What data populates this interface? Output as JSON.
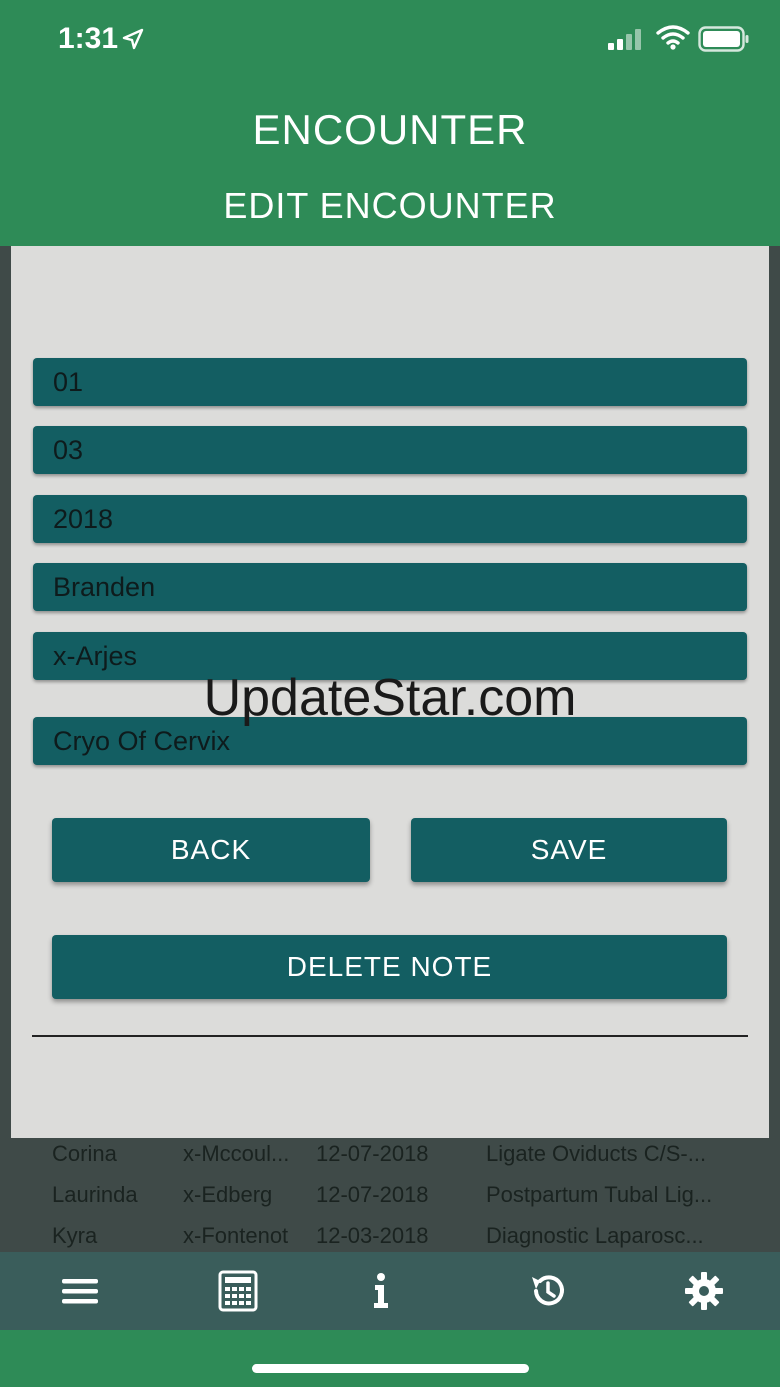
{
  "status_bar": {
    "time": "1:31"
  },
  "header": {
    "app_title": "ENCOUNTER",
    "page_title": "EDIT ENCOUNTER"
  },
  "form": {
    "month": "01",
    "day": "03",
    "year": "2018",
    "first_name": "Branden",
    "last_name": "x-Arjes",
    "procedure": "Cryo Of Cervix"
  },
  "buttons": {
    "back": "BACK",
    "save": "SAVE",
    "delete": "DELETE NOTE"
  },
  "watermark": "UpdateStar.com",
  "list": {
    "rows": [
      {
        "first": "Corina",
        "last": "x-Mccoul...",
        "date": "12-07-2018",
        "procedure": "Ligate Oviducts C/S-..."
      },
      {
        "first": "Laurinda",
        "last": "x-Edberg",
        "date": "12-07-2018",
        "procedure": "Postpartum Tubal Lig..."
      },
      {
        "first": "Kyra",
        "last": "x-Fontenot",
        "date": "12-03-2018",
        "procedure": "Diagnostic Laparosc..."
      }
    ]
  },
  "tabbar": {
    "items": [
      "menu-icon",
      "calculator-icon",
      "info-icon",
      "history-icon",
      "gear-icon"
    ]
  },
  "colors": {
    "brand_green": "#2e8b57",
    "field_teal": "#135e62",
    "tabbar": "#3a5d5b",
    "panel": "#dcdcda"
  }
}
